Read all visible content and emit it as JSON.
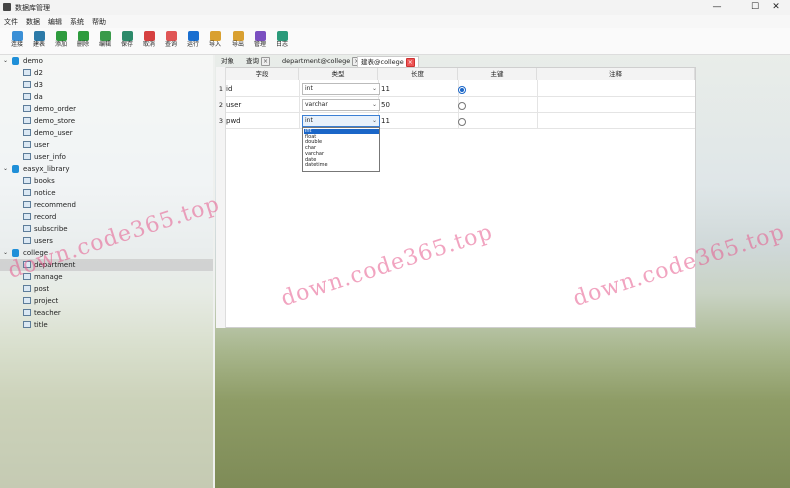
{
  "window": {
    "title": "数据库管理",
    "minimize": "—",
    "maximize": "☐",
    "close": "✕"
  },
  "menu": [
    "文件",
    "数据",
    "编辑",
    "系统",
    "帮助"
  ],
  "toolbar": [
    {
      "label": "连接",
      "icon": "connect-icon",
      "color": "#3a8fd6"
    },
    {
      "label": "建表",
      "icon": "create-table-icon",
      "color": "#2c7aa8"
    },
    {
      "label": "添加",
      "icon": "add-icon",
      "color": "#2e9b3e"
    },
    {
      "label": "删除",
      "icon": "delete-icon",
      "color": "#2e9b3e"
    },
    {
      "label": "编辑",
      "icon": "edit-icon",
      "color": "#3a9a4a"
    },
    {
      "label": "保存",
      "icon": "save-icon",
      "color": "#2c8a6a"
    },
    {
      "label": "取消",
      "icon": "cancel-icon",
      "color": "#d64040"
    },
    {
      "label": "查询",
      "icon": "query-icon",
      "color": "#e05555"
    },
    {
      "label": "运行",
      "icon": "run-icon",
      "color": "#1a6fd0"
    },
    {
      "label": "导入",
      "icon": "import-icon",
      "color": "#d9a030"
    },
    {
      "label": "导出",
      "icon": "export-icon",
      "color": "#d9a030"
    },
    {
      "label": "管理",
      "icon": "manage-icon",
      "color": "#7a4fc0"
    },
    {
      "label": "日志",
      "icon": "log-icon",
      "color": "#2a9a7a"
    }
  ],
  "tree": [
    {
      "name": "demo",
      "type": "db",
      "children": [
        "d2",
        "d3",
        "da",
        "demo_order",
        "demo_store",
        "demo_user",
        "user",
        "user_info"
      ]
    },
    {
      "name": "easyx_library",
      "type": "db",
      "children": [
        "books",
        "notice",
        "recommend",
        "record",
        "subscribe",
        "users"
      ]
    },
    {
      "name": "college",
      "type": "db",
      "children": [
        "department",
        "manage",
        "post",
        "project",
        "teacher",
        "title"
      ]
    }
  ],
  "selected_table": "department",
  "tabs": [
    {
      "label": "对象",
      "closable": false
    },
    {
      "label": "查询",
      "closable": true
    },
    {
      "label": "department@college",
      "closable": true
    },
    {
      "label": "建表@college",
      "closable": true,
      "active": true
    }
  ],
  "grid": {
    "columns": [
      "字段",
      "类型",
      "长度",
      "主键",
      "注释"
    ],
    "rows": [
      {
        "num": "1",
        "field": "id",
        "type": "int",
        "length": "11",
        "pk": true
      },
      {
        "num": "2",
        "field": "user",
        "type": "varchar",
        "length": "50",
        "pk": false
      },
      {
        "num": "3",
        "field": "pwd",
        "type": "int",
        "length": "11",
        "pk": false
      }
    ]
  },
  "type_dropdown": {
    "options": [
      "int",
      "float",
      "double",
      "char",
      "varchar",
      "date",
      "datetime"
    ],
    "selected": "int"
  },
  "watermark": "down.code365.top",
  "bg_colors": {
    "sky": "#dfe6e8",
    "field": "#8e9c66"
  }
}
